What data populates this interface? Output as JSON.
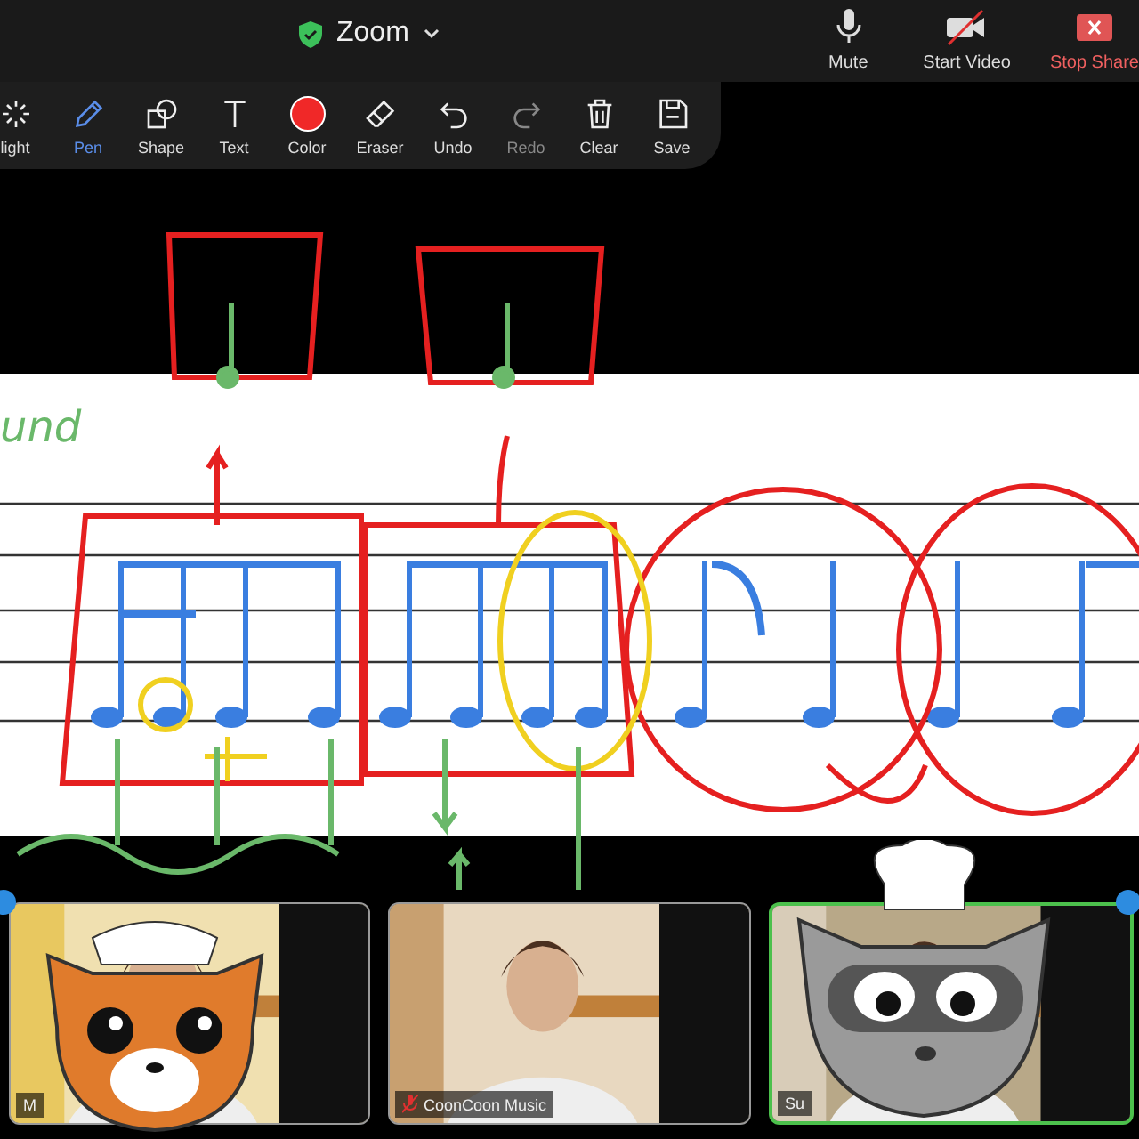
{
  "title_bar": {
    "title": "Zoom",
    "controls": [
      {
        "kind": "mic",
        "label": "Mute"
      },
      {
        "kind": "video-off",
        "label": "Start Video"
      },
      {
        "kind": "stop-share",
        "label": "Stop Share"
      }
    ]
  },
  "toolbar": {
    "tools": [
      {
        "kind": "spotlight",
        "label": "light",
        "selected": false,
        "disabled": false
      },
      {
        "kind": "pen",
        "label": "Pen",
        "selected": true,
        "disabled": false
      },
      {
        "kind": "shape",
        "label": "Shape",
        "selected": false,
        "disabled": false
      },
      {
        "kind": "text",
        "label": "Text",
        "selected": false,
        "disabled": false
      },
      {
        "kind": "color",
        "label": "Color",
        "selected": false,
        "disabled": false,
        "color": "#f02828"
      },
      {
        "kind": "eraser",
        "label": "Eraser",
        "selected": false,
        "disabled": false
      },
      {
        "kind": "undo",
        "label": "Undo",
        "selected": false,
        "disabled": false
      },
      {
        "kind": "redo",
        "label": "Redo",
        "selected": false,
        "disabled": true
      },
      {
        "kind": "clear",
        "label": "Clear",
        "selected": false,
        "disabled": false
      },
      {
        "kind": "save",
        "label": "Save",
        "selected": false,
        "disabled": false
      }
    ]
  },
  "shared_screen": {
    "annotation_text": "und"
  },
  "participants": [
    {
      "name": "M",
      "muted": false,
      "active": false,
      "kind": "panda"
    },
    {
      "name": "CoonCoon Music",
      "muted": true,
      "active": false,
      "kind": "plain"
    },
    {
      "name": "Su",
      "muted": false,
      "active": true,
      "kind": "raccoon"
    }
  ]
}
